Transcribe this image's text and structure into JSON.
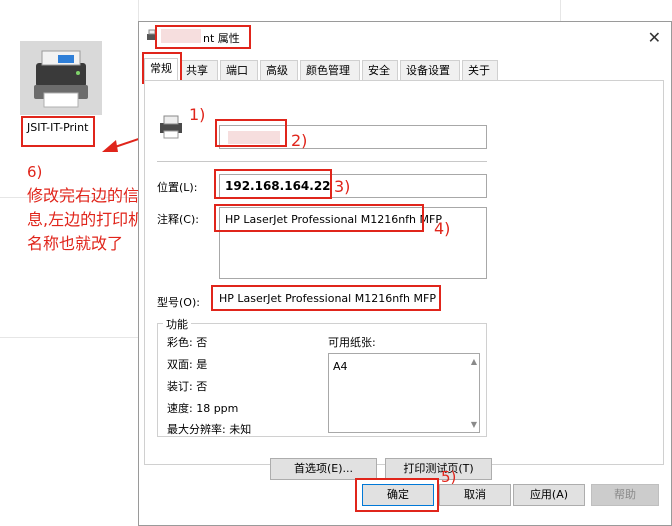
{
  "background": {
    "printer_name": "JSIT-IT-Print",
    "note_number": "6)",
    "note_text": "修改完右边的信息,左边的打印机名称也就改了"
  },
  "dialog": {
    "title_suffix": "nt 属性",
    "close_glyph": "✕",
    "tabs": [
      "常规",
      "共享",
      "端口",
      "高级",
      "颜色管理",
      "安全",
      "设备设置",
      "关于"
    ],
    "active_tab": "常规",
    "location_label": "位置(L):",
    "location_value": "192.168.164.22",
    "comment_label": "注释(C):",
    "comment_value": "HP LaserJet Professional M1216nfh MFP",
    "model_label": "型号(O):",
    "model_value": "HP LaserJet Professional M1216nfh MFP",
    "features": {
      "title": "功能",
      "color": "彩色: 否",
      "duplex": "双面: 是",
      "staple": "装订: 否",
      "speed": "速度: 18 ppm",
      "max_res": "最大分辨率: 未知",
      "paper_label": "可用纸张:",
      "paper_items": [
        "A4"
      ]
    },
    "prefs_button": "首选项(E)...",
    "test_page_button": "打印测试页(T)",
    "ok_button": "确定",
    "cancel_button": "取消",
    "apply_button": "应用(A)",
    "help_button": "帮助"
  },
  "annotations": {
    "a1": "1)",
    "a2": "2)",
    "a3": "3)",
    "a4": "4)",
    "a5": "5)"
  },
  "colors": {
    "annotation_red": "#e0251b",
    "dialog_border": "#9a9a9a"
  }
}
